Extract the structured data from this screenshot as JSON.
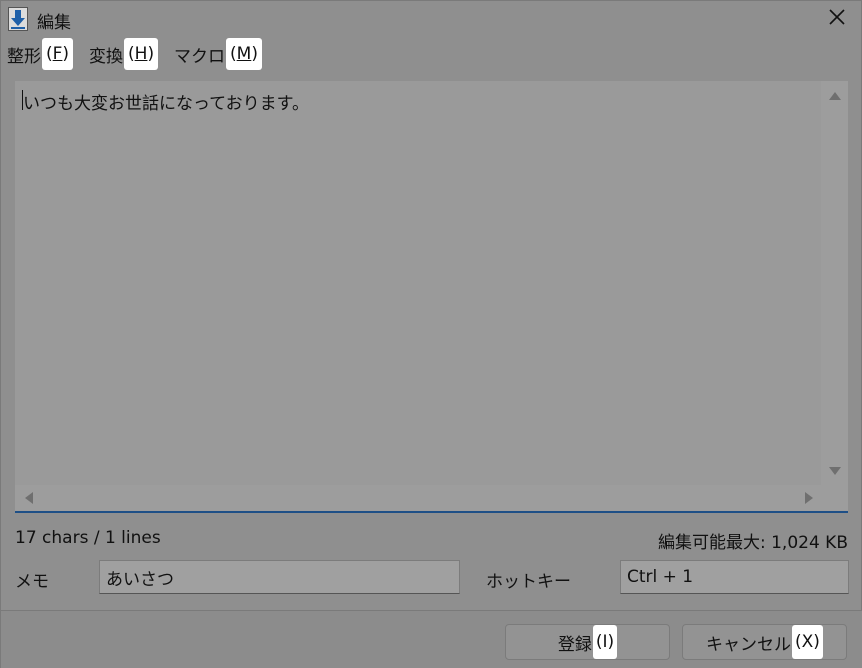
{
  "window": {
    "title": "編集",
    "close_symbol": "✕",
    "icon": "download-arrow-icon",
    "accent_color": "#1e4f86"
  },
  "menu": {
    "items": [
      {
        "label": "整形",
        "shortcut": "(F)",
        "key": "F"
      },
      {
        "label": "変換",
        "shortcut": "(H)",
        "key": "H"
      },
      {
        "label": "マクロ",
        "shortcut": "(M)",
        "key": "M"
      }
    ]
  },
  "editor": {
    "content": "いつも大変お世話になっております。"
  },
  "status": {
    "count": "17 chars / 1 lines",
    "max_size": "編集可能最大: 1,024 KB"
  },
  "fields": {
    "memo_label": "メモ",
    "memo_value": "あいさつ",
    "hotkey_label": "ホットキー",
    "hotkey_value": "Ctrl + 1"
  },
  "buttons": {
    "register_label": "登録",
    "register_shortcut": "(I)",
    "cancel_label": "キャンセル",
    "cancel_shortcut": "(X)"
  }
}
